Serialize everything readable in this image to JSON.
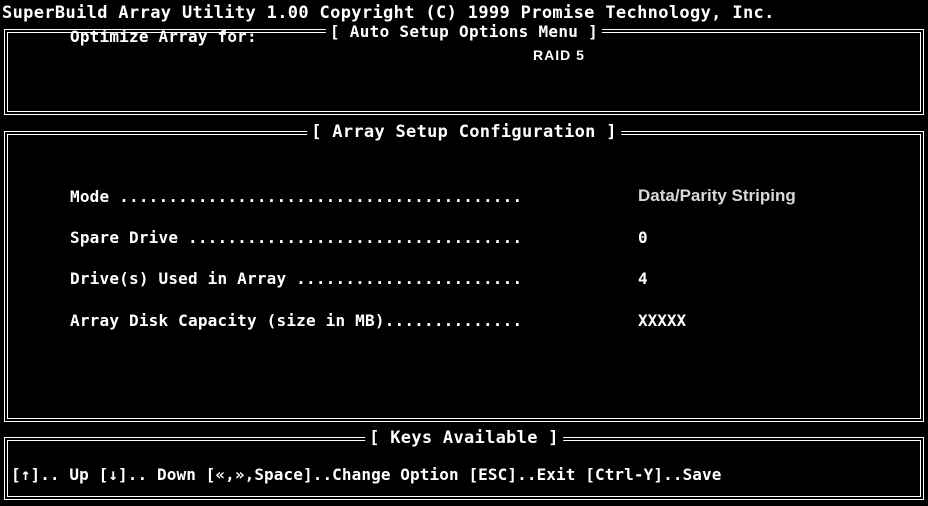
{
  "header": {
    "title": "SuperBuild Array Utility 1.00 Copyright (C) 1999 Promise Technology, Inc."
  },
  "auto_setup": {
    "heading": "[ Auto Setup Options Menu ]",
    "optimize_label": "Optimize Array for:",
    "optimize_value": "RAID 5"
  },
  "array_config": {
    "heading": "[ Array Setup Configuration ]",
    "rows": [
      {
        "label": "Mode .........................................",
        "value": "Data/Parity Striping"
      },
      {
        "label": "Spare Drive ..................................",
        "value": "0"
      },
      {
        "label": "Drive(s) Used in Array .......................",
        "value": "4"
      },
      {
        "label": "Array Disk Capacity (size in MB)..............",
        "value": "XXXXX"
      }
    ]
  },
  "keys": {
    "heading": "[ Keys Available ]",
    "line": "[↑].. Up [↓].. Down  [«,»,Space]..Change Option  [ESC]..Exit [Ctrl-Y]..Save"
  }
}
